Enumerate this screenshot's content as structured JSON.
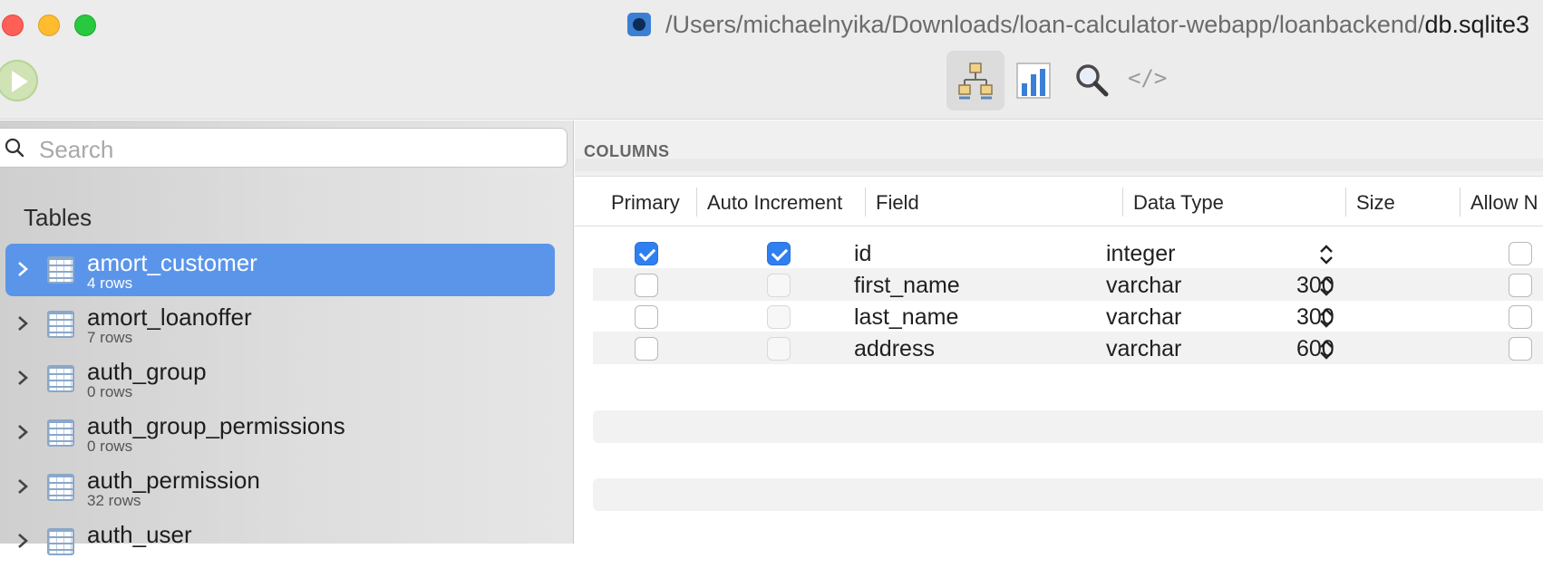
{
  "window": {
    "title_path": "/Users/michaelnyika/Downloads/loan-calculator-webapp/loanbackend/",
    "title_file": "db.sqlite3"
  },
  "toolbar": {
    "run_icon": "play-icon",
    "tools": [
      {
        "name": "structure-icon",
        "active": true
      },
      {
        "name": "chart-icon",
        "active": false
      },
      {
        "name": "search-icon",
        "active": false
      },
      {
        "name": "code-icon",
        "label": "</>",
        "active": false
      }
    ]
  },
  "sidebar": {
    "search_placeholder": "Search",
    "heading": "Tables",
    "tables": [
      {
        "name": "amort_customer",
        "rows": "4 rows",
        "selected": true
      },
      {
        "name": "amort_loanoffer",
        "rows": "7 rows",
        "selected": false
      },
      {
        "name": "auth_group",
        "rows": "0 rows",
        "selected": false
      },
      {
        "name": "auth_group_permissions",
        "rows": "0 rows",
        "selected": false
      },
      {
        "name": "auth_permission",
        "rows": "32 rows",
        "selected": false
      },
      {
        "name": "auth_user",
        "rows": "",
        "selected": false
      }
    ]
  },
  "main": {
    "section_label": "COLUMNS",
    "headers": [
      "Primary",
      "Auto Increment",
      "Field",
      "Data Type",
      "Size",
      "Allow N"
    ],
    "rows": [
      {
        "primary": true,
        "auto_increment": true,
        "field": "id",
        "data_type": "integer",
        "size": "",
        "allow_null": false
      },
      {
        "primary": false,
        "auto_increment": false,
        "field": "first_name",
        "data_type": "varchar",
        "size": "300",
        "allow_null": false
      },
      {
        "primary": false,
        "auto_increment": false,
        "field": "last_name",
        "data_type": "varchar",
        "size": "300",
        "allow_null": false
      },
      {
        "primary": false,
        "auto_increment": false,
        "field": "address",
        "data_type": "varchar",
        "size": "600",
        "allow_null": false
      }
    ]
  },
  "colors": {
    "selection": "#5b95ea",
    "checkbox_checked": "#2f7ff0"
  }
}
